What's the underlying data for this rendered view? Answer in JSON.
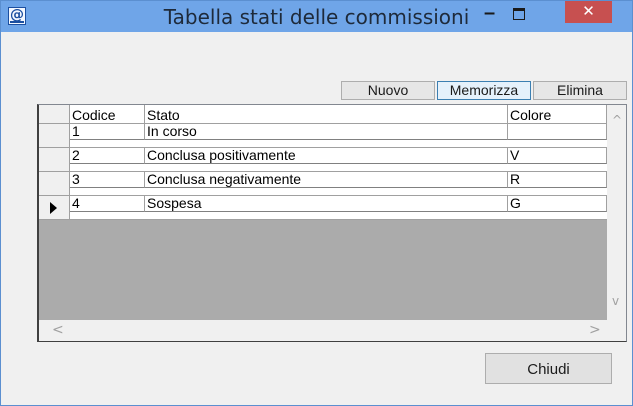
{
  "window": {
    "title": "Tabella stati delle commissioni",
    "icon": "app-logo-icon",
    "controls": {
      "minimize": "–",
      "close": "✕"
    }
  },
  "toolbar": {
    "new_label": "Nuovo",
    "save_label": "Memorizza",
    "delete_label": "Elimina"
  },
  "grid": {
    "columns": [
      "Codice",
      "Stato",
      "Colore"
    ],
    "rows": [
      {
        "codice": "1",
        "stato": "In corso",
        "colore": "",
        "current": false
      },
      {
        "codice": "2",
        "stato": "Conclusa positivamente",
        "colore": "V",
        "current": false
      },
      {
        "codice": "3",
        "stato": "Conclusa negativamente",
        "colore": "R",
        "current": false
      },
      {
        "codice": "4",
        "stato": "Sospesa",
        "colore": "G",
        "current": true
      }
    ],
    "scroll": {
      "up": "^",
      "down": "v",
      "left": "<",
      "right": ">"
    }
  },
  "footer": {
    "close_label": "Chiudi"
  },
  "colors": {
    "titlebar": "#6fa5e8",
    "close_button": "#c75050",
    "window_bg": "#f0f0f0"
  }
}
